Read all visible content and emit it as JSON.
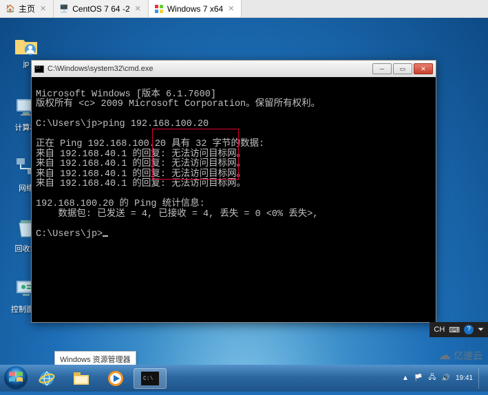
{
  "tabs": [
    {
      "label": "主页",
      "icon": "home"
    },
    {
      "label": "CentOS 7 64 -2",
      "icon": "vm"
    },
    {
      "label": "Windows 7 x64",
      "icon": "win"
    }
  ],
  "desktop_icons": {
    "jp": "jp",
    "computer": "计算机",
    "network": "网络",
    "recycle": "回收站",
    "control": "控制面板"
  },
  "cmd": {
    "title": "C:\\Windows\\system32\\cmd.exe",
    "lines": {
      "l0": "Microsoft Windows [版本 6.1.7600]",
      "l1": "版权所有 <c> 2009 Microsoft Corporation。保留所有权利。",
      "l2": "",
      "l3": "C:\\Users\\jp>ping 192.168.100.20",
      "l4": "",
      "l5": "正在 Ping 192.168.100.20 具有 32 字节的数据:",
      "l6": "来自 192.168.40.1 的回复: 无法访问目标网。",
      "l7": "来自 192.168.40.1 的回复: 无法访问目标网。",
      "l8": "来自 192.168.40.1 的回复: 无法访问目标网。",
      "l9": "来自 192.168.40.1 的回复: 无法访问目标网。",
      "l10": "",
      "l11": "192.168.100.20 的 Ping 统计信息:",
      "l12": "    数据包: 已发送 = 4, 已接收 = 4, 丢失 = 0 <0% 丢失>,",
      "l13": "",
      "l14": "C:\\Users\\jp>"
    }
  },
  "tooltip": "Windows 资源管理器",
  "lang": {
    "ch": "CH",
    "arrow": "⏷"
  },
  "tray": {
    "time": "19:41"
  },
  "watermark": "亿速云"
}
